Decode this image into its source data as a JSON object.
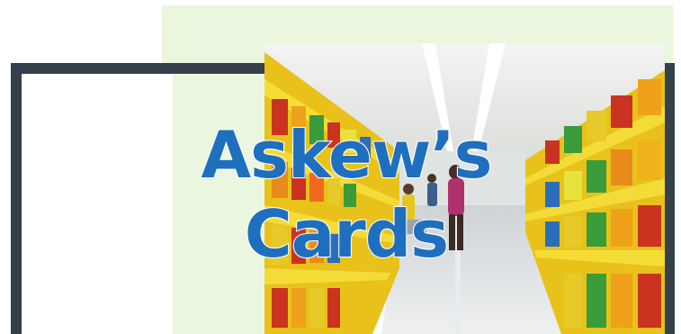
{
  "headline": {
    "line1": "Askew’s",
    "line2": "Cards"
  },
  "colors": {
    "frame": "#36404c",
    "mint": "#eaf6dd",
    "headline": "#1f6fbf",
    "shelf_yellow": "#f2d21a"
  },
  "image": {
    "subject": "supermarket-aisle-photo"
  }
}
